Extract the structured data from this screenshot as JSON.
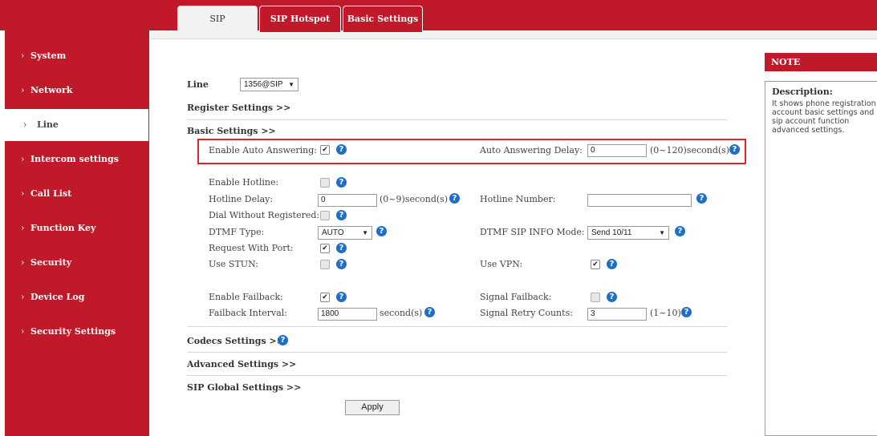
{
  "sidebar": {
    "items": [
      {
        "label": "System"
      },
      {
        "label": "Network"
      },
      {
        "label": "Line"
      },
      {
        "label": "Intercom settings"
      },
      {
        "label": "Call List"
      },
      {
        "label": "Function Key"
      },
      {
        "label": "Security"
      },
      {
        "label": "Device Log"
      },
      {
        "label": "Security Settings"
      }
    ],
    "chevron": "›"
  },
  "tabs": [
    {
      "label": "SIP"
    },
    {
      "label": "SIP Hotspot"
    },
    {
      "label": "Basic Settings"
    }
  ],
  "line": {
    "label": "Line",
    "selected": "1356@SIP"
  },
  "sections": {
    "register": "Register Settings >>",
    "basic": "Basic Settings >>",
    "codecs": "Codecs Settings >>",
    "advanced": "Advanced Settings >>",
    "sip_global": "SIP Global Settings >>"
  },
  "fields": {
    "auto_answer_label": "Enable Auto Answering:",
    "auto_answer_delay_label": "Auto Answering Delay:",
    "auto_answer_delay_value": "0",
    "auto_answer_delay_range": "(0~120)second(s)",
    "hotline_label": "Enable Hotline:",
    "hotline_delay_label": "Hotline Delay:",
    "hotline_delay_value": "0",
    "hotline_delay_range": "(0~9)second(s)",
    "hotline_number_label": "Hotline Number:",
    "hotline_number_value": "",
    "dial_without_label": "Dial Without Registered:",
    "dtmf_type_label": "DTMF Type:",
    "dtmf_type_value": "AUTO",
    "dtmf_sip_info_label": "DTMF SIP INFO Mode:",
    "dtmf_sip_info_value": "Send 10/11",
    "request_port_label": "Request With Port:",
    "use_stun_label": "Use STUN:",
    "use_vpn_label": "Use VPN:",
    "enable_failback_label": "Enable Failback:",
    "signal_failback_label": "Signal Failback:",
    "failback_interval_label": "Failback Interval:",
    "failback_interval_value": "1800",
    "failback_interval_unit": "second(s)",
    "signal_retry_label": "Signal Retry Counts:",
    "signal_retry_value": "3",
    "signal_retry_range": "(1~10)"
  },
  "checks": {
    "on": "✔",
    "off": ""
  },
  "help_glyph": "?",
  "apply_label": "Apply",
  "note": {
    "title": "NOTE",
    "desc_title": "Description:",
    "desc": "It shows phone registration account basic settings and sip account function advanced settings."
  },
  "colors": {
    "brand": "#c0192a",
    "help": "#1f6fc5",
    "highlight": "#e0242b"
  }
}
